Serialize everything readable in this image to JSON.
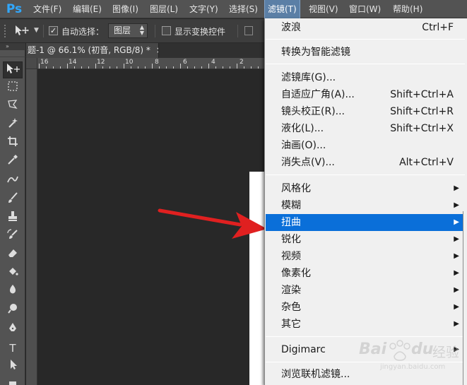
{
  "app": {
    "logo": "Ps",
    "brand_color": "#31a8ff"
  },
  "menubar": {
    "items": [
      {
        "label": "文件(F)"
      },
      {
        "label": "编辑(E)"
      },
      {
        "label": "图像(I)"
      },
      {
        "label": "图层(L)"
      },
      {
        "label": "文字(Y)"
      },
      {
        "label": "选择(S)"
      },
      {
        "label": "滤镜(T)"
      },
      {
        "label": "视图(V)"
      },
      {
        "label": "窗口(W)"
      },
      {
        "label": "帮助(H)"
      }
    ],
    "active_index": 6
  },
  "options": {
    "auto_select_label": "自动选择：",
    "auto_select_checked": "✓",
    "target_value": "图层",
    "show_transform_label": "显示变换控件"
  },
  "tools_panel": {
    "collapse_glyph": "»"
  },
  "document": {
    "tab_title": "题-1 @ 66.1% (初音, RGB/8) *",
    "close_glyph": "×",
    "ruler_labels": [
      "16",
      "14",
      "12",
      "10",
      "8",
      "6",
      "4",
      "2"
    ]
  },
  "filter_menu": {
    "items": [
      {
        "label": "波浪",
        "shortcut": "Ctrl+F"
      },
      {
        "label": "转换为智能滤镜",
        "shortcut": ""
      },
      {
        "label": "滤镜库(G)...",
        "shortcut": ""
      },
      {
        "label": "自适应广角(A)...",
        "shortcut": "Shift+Ctrl+A"
      },
      {
        "label": "镜头校正(R)...",
        "shortcut": "Shift+Ctrl+R"
      },
      {
        "label": "液化(L)...",
        "shortcut": "Shift+Ctrl+X"
      },
      {
        "label": "油画(O)...",
        "shortcut": ""
      },
      {
        "label": "消失点(V)...",
        "shortcut": "Alt+Ctrl+V"
      },
      {
        "label": "风格化",
        "submenu": true
      },
      {
        "label": "模糊",
        "submenu": true
      },
      {
        "label": "扭曲",
        "submenu": true,
        "highlighted": true
      },
      {
        "label": "锐化",
        "submenu": true
      },
      {
        "label": "视频",
        "submenu": true
      },
      {
        "label": "像素化",
        "submenu": true
      },
      {
        "label": "渲染",
        "submenu": true
      },
      {
        "label": "杂色",
        "submenu": true
      },
      {
        "label": "其它",
        "submenu": true
      },
      {
        "label": "Digimarc",
        "submenu": true
      },
      {
        "label": "浏览联机滤镜...",
        "shortcut": ""
      }
    ],
    "submenu_glyph": "▶",
    "highlight_color": "#0a6fd9"
  },
  "annotation": {
    "arrow_color": "#e02020"
  },
  "watermark": {
    "text": "Bai",
    "text2": "du",
    "text3": "经验",
    "text4": "jingyan.baidu.com"
  }
}
